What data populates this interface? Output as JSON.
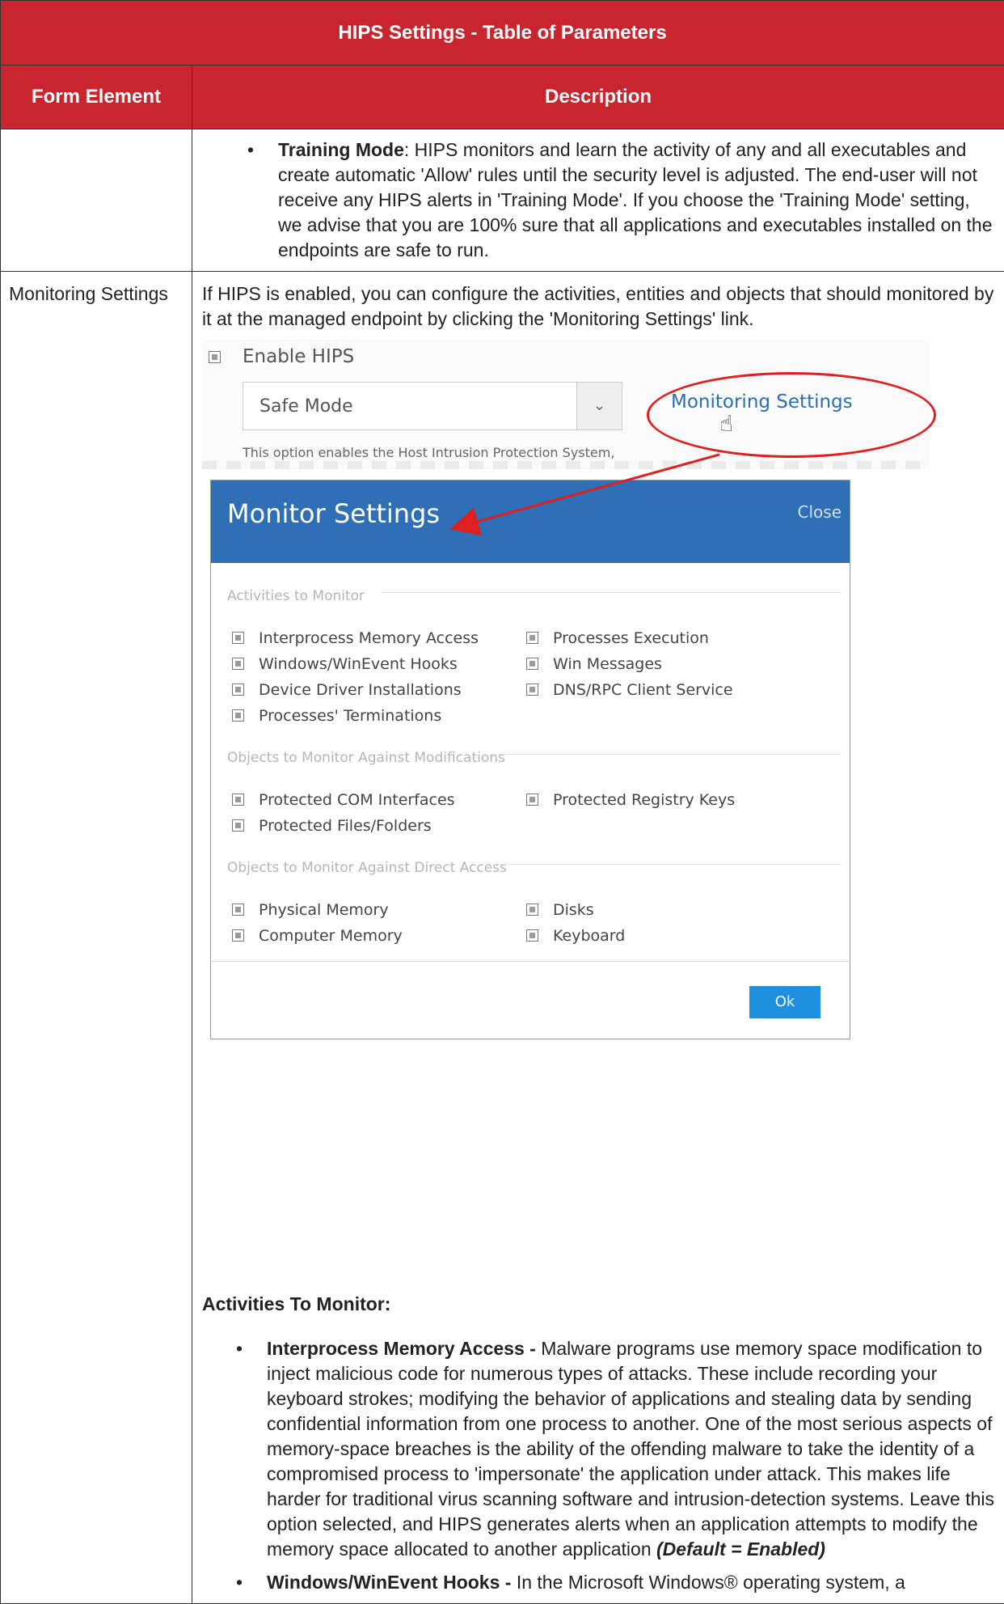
{
  "table": {
    "title": "HIPS Settings - Table of Parameters",
    "col_form_element": "Form Element",
    "col_description": "Description"
  },
  "row1": {
    "bullet_bold": "Training Mode",
    "bullet_text": ": HIPS monitors and learn the activity of any and all executables and create automatic 'Allow' rules until the security level is adjusted. The end-user will not receive any HIPS alerts in 'Training Mode'. If you choose the 'Training Mode' setting, we advise that you are 100% sure that all applications and executables installed on the endpoints are safe to run."
  },
  "row2": {
    "form_element": "Monitoring Settings",
    "intro": "If HIPS is enabled, you can configure the activities, entities and objects that should monitored by it at the managed endpoint by clicking the 'Monitoring Settings' link.",
    "activities_heading": "Activities To Monitor:",
    "b1_bold": "Interprocess Memory Access - ",
    "b1_text": "Malware programs use memory space modification to inject malicious code for numerous types of attacks. These include recording your keyboard strokes; modifying the behavior of applications and stealing data by sending confidential information from one process to another. One of the most serious aspects of memory-space breaches is the ability of the offending malware to take the identity of a compromised process to 'impersonate' the application under attack. This makes life harder for traditional virus scanning software and intrusion-detection systems. Leave this option selected, and HIPS generates alerts when an application attempts to modify the memory space allocated to another application ",
    "b1_default": "(Default = Enabled)",
    "b2_bold": "Windows/WinEvent Hooks - ",
    "b2_text": "In the Microsoft Windows® operating system, a"
  },
  "snippet": {
    "enable_label": "Enable HIPS",
    "select_value": "Safe Mode",
    "link": "Monitoring Settings",
    "hint": "This option enables the Host Intrusion Protection System,"
  },
  "dialog": {
    "title": "Monitor Settings",
    "close": "Close",
    "section1": "Activities to Monitor",
    "s1_left": [
      "Interprocess Memory Access",
      "Windows/WinEvent Hooks",
      "Device Driver Installations",
      "Processes' Terminations"
    ],
    "s1_right": [
      "Processes Execution",
      "Win Messages",
      "DNS/RPC Client Service"
    ],
    "section2": "Objects to Monitor Against Modifications",
    "s2_left": [
      "Protected COM Interfaces",
      "Protected Files/Folders"
    ],
    "s2_right": [
      "Protected Registry Keys"
    ],
    "section3": "Objects to Monitor Against Direct Access",
    "s3_left": [
      "Physical Memory",
      "Computer Memory"
    ],
    "s3_right": [
      "Disks",
      "Keyboard"
    ],
    "ok": "Ok"
  }
}
